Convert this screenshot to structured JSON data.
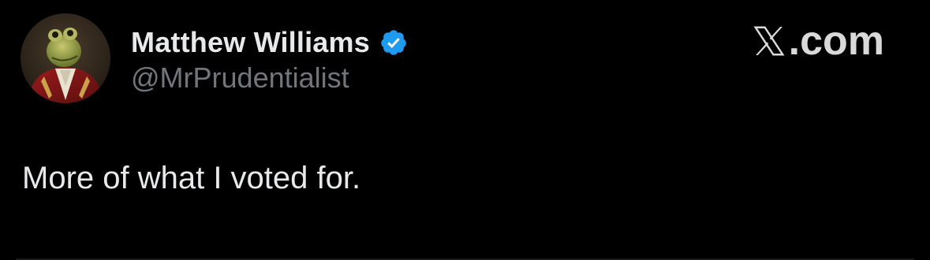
{
  "tweet": {
    "author": {
      "display_name": "Matthew Williams",
      "handle": "@MrPrudentialist",
      "verified": true,
      "verified_icon": "verified-badge-icon",
      "avatar": "frog-portrait-avatar"
    },
    "brand": {
      "icon": "x-logo-icon",
      "suffix": ".com"
    },
    "text": "More of what I voted for."
  },
  "colors": {
    "background": "#000000",
    "primary_text": "#e7e9ea",
    "secondary_text": "#71767b",
    "verified_blue": "#1d9bf0"
  }
}
